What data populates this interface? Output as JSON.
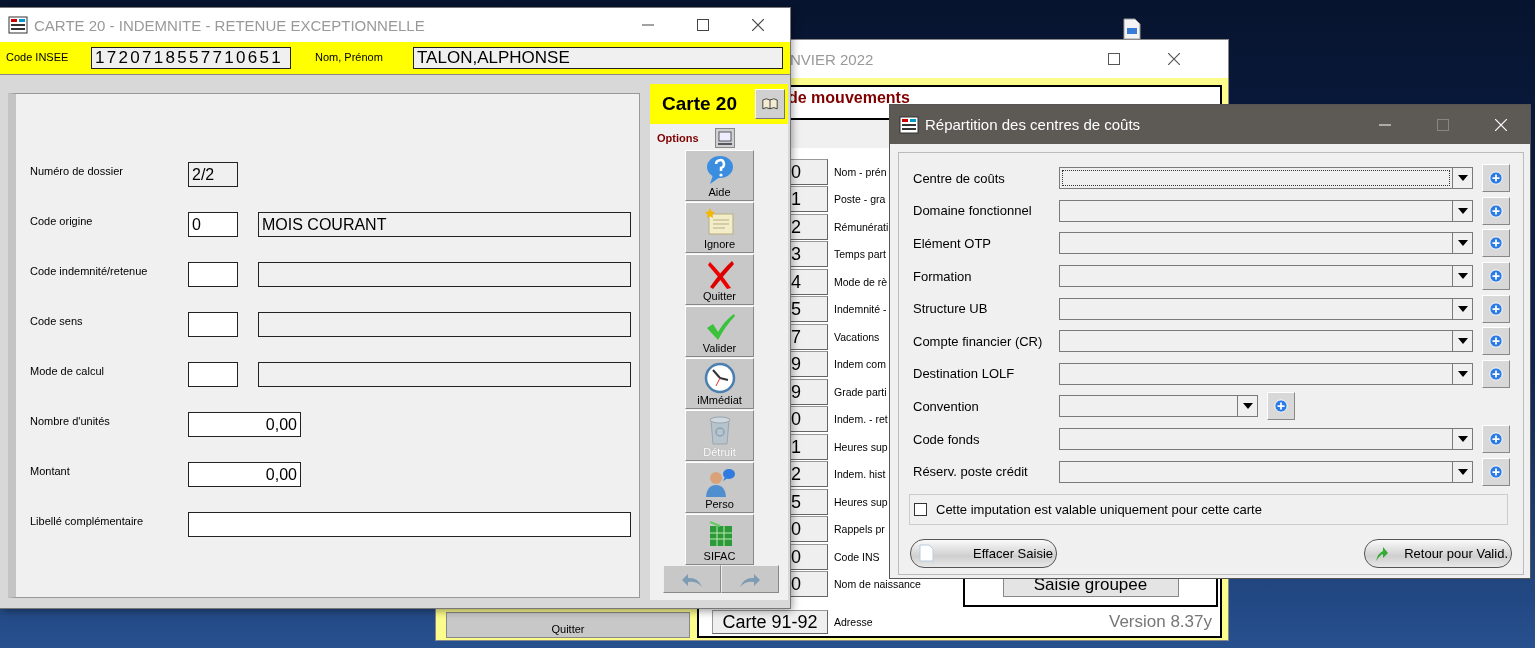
{
  "background_window": {
    "title": "NVIER 2022",
    "heading": "de mouvements",
    "cards": [
      {
        "kind": "code",
        "code": "0",
        "label": "Nom - prén"
      },
      {
        "kind": "code",
        "code": "1",
        "label": "Poste - gra"
      },
      {
        "kind": "code",
        "code": "2",
        "label": "Rémunérati"
      },
      {
        "kind": "code",
        "code": "3",
        "label": "Temps part"
      },
      {
        "kind": "code",
        "code": "4",
        "label": "Mode de rè"
      },
      {
        "kind": "code",
        "code": "5",
        "label": "Indemnité -"
      },
      {
        "kind": "code",
        "code": "7",
        "label": "Vacations"
      },
      {
        "kind": "code",
        "code": "9",
        "label": "Indem com"
      },
      {
        "kind": "code",
        "code": "9",
        "label": "Grade parti"
      },
      {
        "kind": "code",
        "code": "0",
        "label": "Indem. - ret"
      },
      {
        "kind": "code",
        "code": "1",
        "label": "Heures sup"
      },
      {
        "kind": "code",
        "code": "2",
        "label": "Indem. hist"
      },
      {
        "kind": "code",
        "code": "5",
        "label": "Heures sup"
      },
      {
        "kind": "code",
        "code": "0",
        "label": "Rappels pr"
      },
      {
        "kind": "code",
        "code": "0",
        "label": "Code INS"
      },
      {
        "kind": "code",
        "code": "0",
        "label": "Nom de naissance"
      },
      {
        "kind": "card",
        "code": "Carte 91-92",
        "label": "Adresse"
      }
    ],
    "group_button": "Saisie groupee",
    "quit_button": "Quitter",
    "version": "Version 8.37y"
  },
  "main_window": {
    "title": "CARTE 20 - INDEMNITE - RETENUE EXCEPTIONNELLE",
    "header": {
      "code_insee_label": "Code INSEE",
      "code_insee": "1720718557710651",
      "name_label": "Nom, Prénom",
      "name": "TALON,ALPHONSE"
    },
    "fields": [
      {
        "label": "Numéro de dossier",
        "kind": "readonly",
        "value": "2/2"
      },
      {
        "label": "Code origine",
        "kind": "code",
        "value": "0",
        "description": "MOIS COURANT"
      },
      {
        "label": "Code indemnité/retenue",
        "kind": "code"
      },
      {
        "label": "Code sens",
        "kind": "code"
      },
      {
        "label": "Mode de calcul",
        "kind": "code"
      },
      {
        "label": "Nombre d'unités",
        "kind": "amount",
        "value": "0,00"
      },
      {
        "label": "Montant",
        "kind": "amount",
        "value": "0,00"
      },
      {
        "label": "Libellé complémentaire",
        "kind": "text"
      }
    ],
    "card_title": "Carte 20",
    "options_label": "Options",
    "actions": [
      {
        "label": "Aide",
        "disabled": false
      },
      {
        "label": "Ignore",
        "disabled": false
      },
      {
        "label": "Quitter",
        "disabled": false
      },
      {
        "label": "Valider",
        "disabled": false
      },
      {
        "label": "iMmédiat",
        "disabled": false
      },
      {
        "label": "Détruit",
        "disabled": true
      },
      {
        "label": "Perso",
        "disabled": false
      },
      {
        "label": "SIFAC",
        "disabled": false
      }
    ]
  },
  "cost_dialog": {
    "title": "Répartition des centres de coûts",
    "rows": [
      {
        "label": "Centre de coûts",
        "kind": "wide",
        "focused": true
      },
      {
        "label": "Domaine fonctionnel",
        "kind": "wide",
        "focused": false
      },
      {
        "label": "Elément OTP",
        "kind": "wide",
        "focused": false
      },
      {
        "label": "Formation",
        "kind": "wide",
        "focused": false
      },
      {
        "label": "Structure UB",
        "kind": "wide",
        "focused": false
      },
      {
        "label": "Compte financier (CR)",
        "kind": "wide",
        "focused": false
      },
      {
        "label": "Destination LOLF",
        "kind": "wide",
        "focused": false
      },
      {
        "label": "Convention",
        "kind": "short",
        "focused": false
      },
      {
        "label": "Code fonds",
        "kind": "wide",
        "focused": false
      },
      {
        "label": "Réserv. poste crédit",
        "kind": "wide",
        "focused": false
      }
    ],
    "checkbox": {
      "label": "Cette imputation est valable uniquement pour cette carte",
      "checked": false
    },
    "buttons": [
      "Effacer Saisie",
      "Retour pour Valid."
    ]
  }
}
